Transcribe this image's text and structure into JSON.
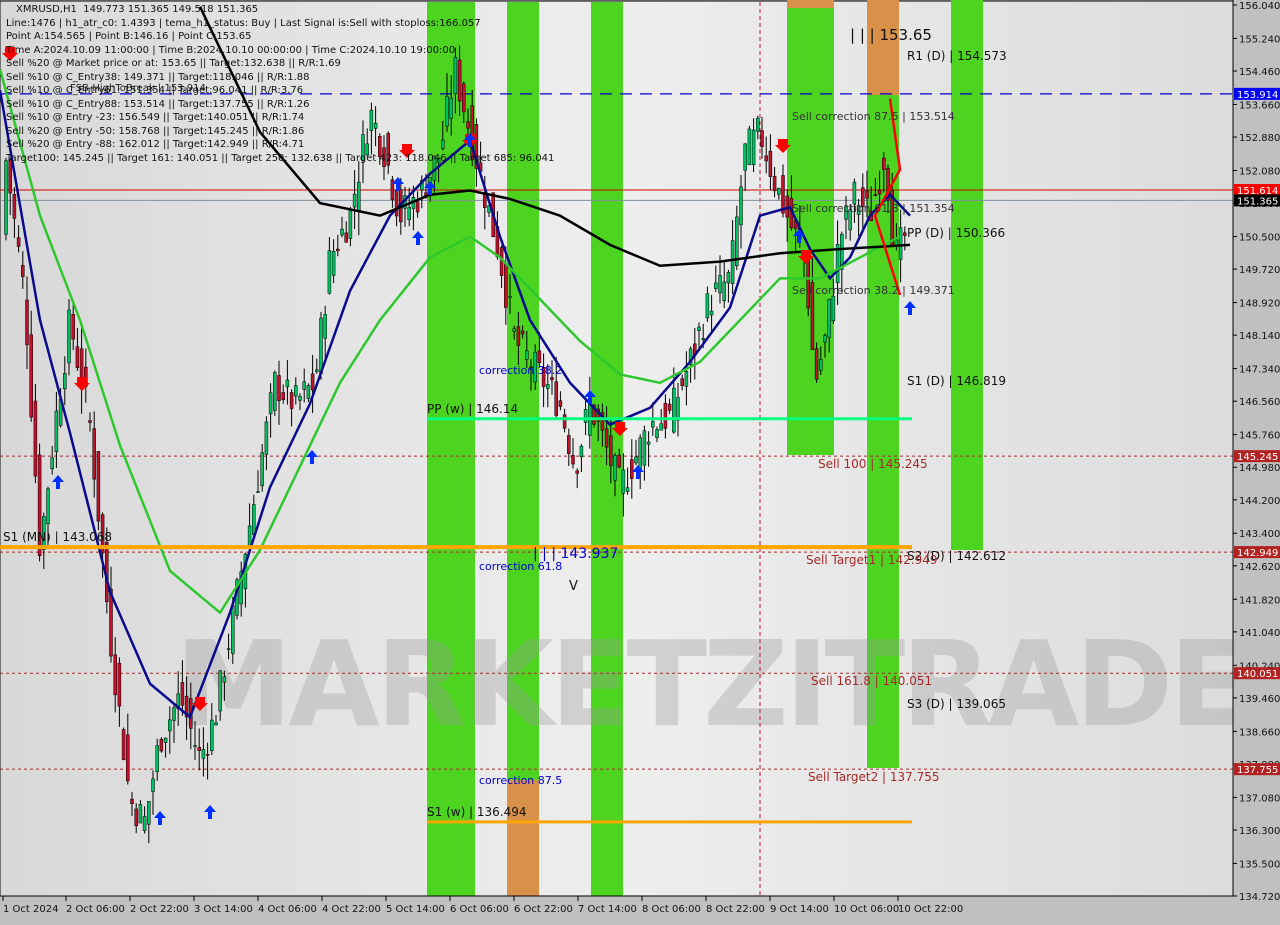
{
  "chart_data": {
    "type": "candlestick",
    "symbol": "XMRUSD,H1",
    "ohlc_header": "149.773 151.365 149.518 151.365",
    "info_lines": [
      "Line:1476 | h1_atr_c0: 1.4393 | tema_h1_status: Buy | Last Signal is:Sell with stoploss:166.057",
      "Point A:154.565 | Point B:146.16 | Point C:153.65",
      "Time A:2024.10.09 11:00:00 | Time B:2024.10.10 00:00:00 | Time C:2024.10.10 19:00:00",
      "Sell %20 @ Market price or at: 153.65 || Target:132.638 || R/R:1.69",
      "Sell %10 @ C_Entry38: 149.371 || Target:118.046 || R/R:1.88",
      "Sell %10 @ C_Entry61: 151.354 || Target:96.041 || R/R:3.76",
      "Sell %10 @ C_Entry88: 153.514 || Target:137.755 || R/R:1.26",
      "Sell %10 @ Entry -23: 156.549 || Target:140.051 || R/R:1.74",
      "Sell %20 @ Entry -50: 158.768 || Target:145.245 || R/R:1.86",
      "Sell %20 @ Entry -88: 162.012 || Target:142.949 || R/R:4.71",
      "Target100: 145.245 || Target 161: 140.051 || Target 250: 132.638 || Target 423: 118.046 || Target 685: 96.041"
    ],
    "fsb_label": "FSB-HighToBreak | 153.914",
    "ylim": [
      134.72,
      156.04
    ],
    "y_ticks": [
      156.04,
      155.24,
      154.46,
      153.66,
      152.88,
      152.08,
      151.3,
      150.5,
      149.72,
      148.92,
      148.14,
      147.34,
      146.56,
      145.76,
      144.98,
      144.2,
      143.4,
      142.62,
      141.82,
      141.04,
      140.24,
      139.46,
      138.66,
      137.88,
      137.08,
      136.3,
      135.5,
      134.72
    ],
    "x_ticks": [
      "1 Oct 2024",
      "2 Oct 06:00",
      "2 Oct 22:00",
      "3 Oct 14:00",
      "4 Oct 06:00",
      "4 Oct 22:00",
      "5 Oct 14:00",
      "6 Oct 06:00",
      "6 Oct 22:00",
      "7 Oct 14:00",
      "8 Oct 06:00",
      "8 Oct 22:00",
      "9 Oct 14:00",
      "10 Oct 06:00",
      "10 Oct 22:00"
    ],
    "price_badges": [
      {
        "value": "153.914",
        "color": "#0000ff",
        "price": 153.914
      },
      {
        "value": "151.614",
        "color": "#ff0000",
        "price": 151.614
      },
      {
        "value": "151.365",
        "color": "#000000",
        "price": 151.365
      },
      {
        "value": "145.245",
        "color": "#b22222",
        "price": 145.245
      },
      {
        "value": "142.949",
        "color": "#b22222",
        "price": 142.949
      },
      {
        "value": "140.051",
        "color": "#b22222",
        "price": 140.051
      },
      {
        "value": "137.755",
        "color": "#b22222",
        "price": 137.755
      }
    ],
    "levels": [
      {
        "label": "R1 (D) | 154.573",
        "price": 154.573
      },
      {
        "label": "PP (D) | 150.366",
        "price": 150.366
      },
      {
        "label": "S1 (D) | 146.819",
        "price": 146.819
      },
      {
        "label": "S2 (D) | 142.612",
        "price": 142.612
      },
      {
        "label": "S3 (D) | 139.065",
        "price": 139.065
      },
      {
        "label": "PP (w) | 146.14",
        "price": 146.14
      },
      {
        "label": "S1 (w) | 136.494",
        "price": 136.494
      },
      {
        "label": "S1 (MN) | 143.068",
        "price": 143.068
      }
    ],
    "sell_levels": [
      {
        "label": "Sell 100 | 145.245",
        "price": 145.245
      },
      {
        "label": "Sell Target1 | 142.949",
        "price": 142.949
      },
      {
        "label": "Sell 161.8 | 140.051",
        "price": 140.051
      },
      {
        "label": "Sell Target2 | 137.755",
        "price": 137.755
      }
    ],
    "corrections": [
      {
        "label": "Sell correction 87.5 | 153.514",
        "price": 153.514
      },
      {
        "label": "Sell correction 61.8 | 151.354",
        "price": 151.354
      },
      {
        "label": "Sell correction 38.2 | 149.371",
        "price": 149.371
      },
      {
        "label": "correction 38.2",
        "price": 147.4
      },
      {
        "label": "correction 61.8",
        "price": 142.6
      },
      {
        "label": "correction 87.5",
        "price": 137.6
      }
    ],
    "wave_labels": [
      {
        "label": "| | | 153.65",
        "price": 155.2
      },
      {
        "label": "| | | 143.937",
        "price": 142.9
      },
      {
        "label": "V",
        "price": 142.0
      }
    ],
    "watermark": "MARKETZITRADE",
    "colors": {
      "bull": "#00c060",
      "bear": "#c0102a",
      "ma_blue": "#0a0a8c",
      "ma_green": "#2ec82e",
      "ma_black": "#000000",
      "band_green": "#4cd420",
      "band_orange": "#d9914a",
      "level_orange": "#ffa500",
      "level_pp": "#00ff80",
      "sell_line": "#a52a2a"
    }
  }
}
